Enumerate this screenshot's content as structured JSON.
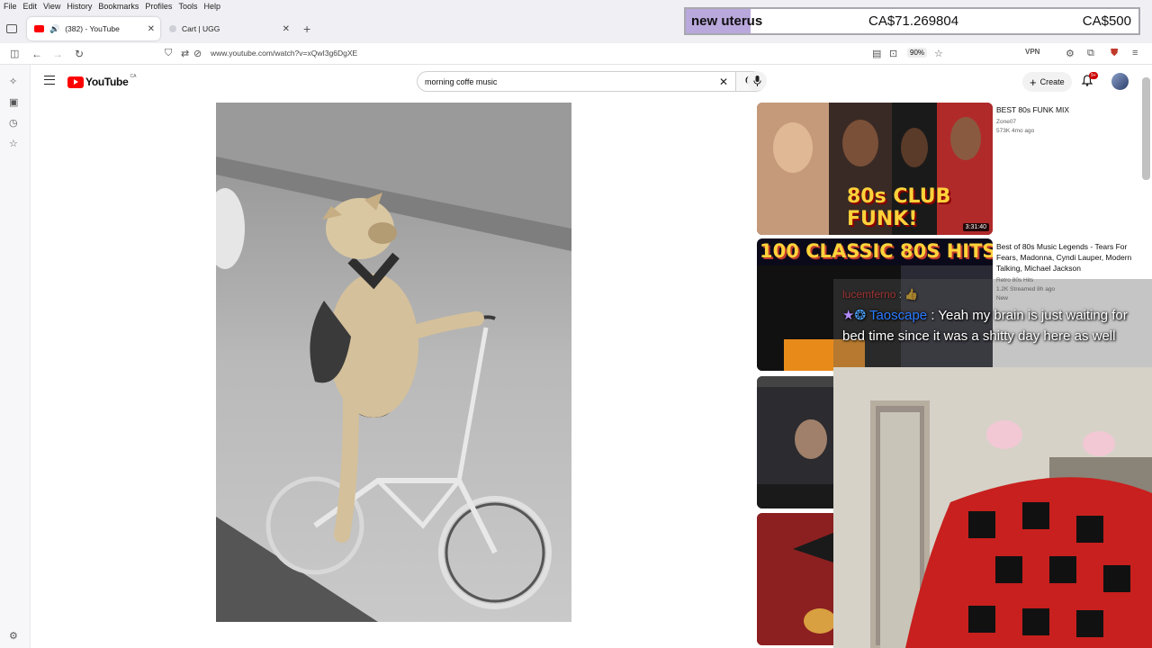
{
  "menu": {
    "items": [
      "File",
      "Edit",
      "View",
      "History",
      "Bookmarks",
      "Profiles",
      "Tools",
      "Help"
    ]
  },
  "tabs": [
    {
      "label": "(382) - YouTube",
      "active": true
    },
    {
      "label": "Cart | UGG",
      "active": false
    }
  ],
  "overlay": {
    "label": "new uterus",
    "amount": "CA$71.269804",
    "goal": "CA$500"
  },
  "nav": {
    "url": "www.youtube.com/watch?v=xQwI3g6DgXE",
    "zoom": "90%"
  },
  "youtube": {
    "logo_text": "YouTube",
    "country": "CA",
    "search_value": "morning coffe music",
    "create_label": "Create",
    "notif_count": "9+"
  },
  "recommendations": [
    {
      "title": "BEST 80s FUNK MIX",
      "channel": "Zone07",
      "meta": "573K  4mo ago",
      "duration": "3:31:40",
      "thumb_text": "80s CLUB FUNK!"
    },
    {
      "title": "Best of 80s Music Legends - Tears For Fears, Madonna, Cyndi Lauper, Modern Talking, Michael Jackson",
      "channel": "Retro 80s Hits",
      "meta": "1.2K  Streamed 8h ago",
      "badge": "New",
      "thumb_text": "100 CLASSIC 80S HITS"
    },
    {
      "title": "",
      "channel": "",
      "meta": ""
    },
    {
      "title": "",
      "channel": "",
      "meta": ""
    }
  ],
  "chat": {
    "msg1_user": "lucemferno",
    "msg2_user": "Taoscape",
    "msg2_text": "Yeah my brain is just waiting for bed time since it was a shitty day here as well"
  },
  "colors": {
    "yt_red": "#ff0000",
    "overlay_accent": "#b9a8dc"
  }
}
